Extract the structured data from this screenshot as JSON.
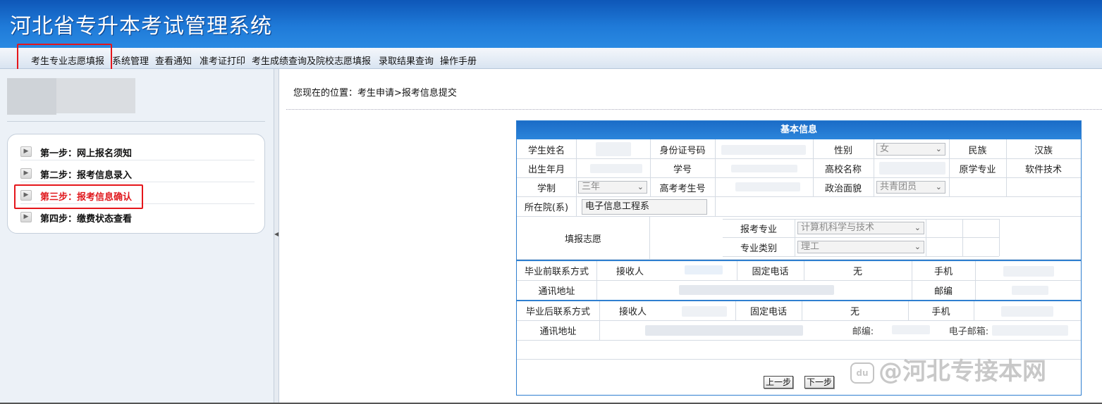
{
  "app": {
    "title": "河北省专升本考试管理系统"
  },
  "menu": [
    "考生专业志愿填报",
    "系统管理",
    "查看通知",
    "准考证打印",
    "考生成绩查询及院校志愿填报",
    "录取结果查询",
    "操作手册"
  ],
  "steps": [
    "第一步：网上报名须知",
    "第二步：报考信息录入",
    "第三步：报考信息确认",
    "第四步：缴费状态查看"
  ],
  "active_step": 3,
  "breadcrumb": "您现在的位置：考生申请>报考信息提交",
  "form": {
    "header": "基本信息",
    "row1": {
      "name_label": "学生姓名",
      "id_label": "身份证号码",
      "gender_label": "性别",
      "gender_value": "女",
      "ethnic_label": "民族",
      "ethnic_value": "汉族"
    },
    "row2": {
      "birth_label": "出生年月",
      "stuno_label": "学号",
      "school_label": "高校名称",
      "major_label": "原学专业",
      "major_value": "软件技术"
    },
    "row3": {
      "length_label": "学制",
      "length_value": "三年",
      "gaokao_label": "高考考生号",
      "political_label": "政治面貌",
      "political_value": "共青团员"
    },
    "row4": {
      "dept_label": "所在院(系)",
      "dept_value": "电子信息工程系"
    },
    "wish": {
      "label": "填报志愿",
      "major_label": "报考专业",
      "major_value": "计算机科学与技术",
      "type_label": "专业类别",
      "type_value": "理工"
    },
    "pre_grad": {
      "label": "毕业前联系方式",
      "receiver_label": "接收人",
      "phone_label": "固定电话",
      "phone_value": "无",
      "mobile_label": "手机",
      "addr_label": "通讯地址",
      "zip_label": "邮编"
    },
    "post_grad": {
      "label": "毕业后联系方式",
      "receiver_label": "接收人",
      "phone_label": "固定电话",
      "phone_value": "无",
      "mobile_label": "手机",
      "addr_label": "通讯地址",
      "zip_label": "邮编:",
      "email_label": "电子邮箱:"
    },
    "prev_button": "上一步",
    "next_button": "下一步"
  },
  "watermark": {
    "logo": "du",
    "text": "@河北专接本网"
  }
}
